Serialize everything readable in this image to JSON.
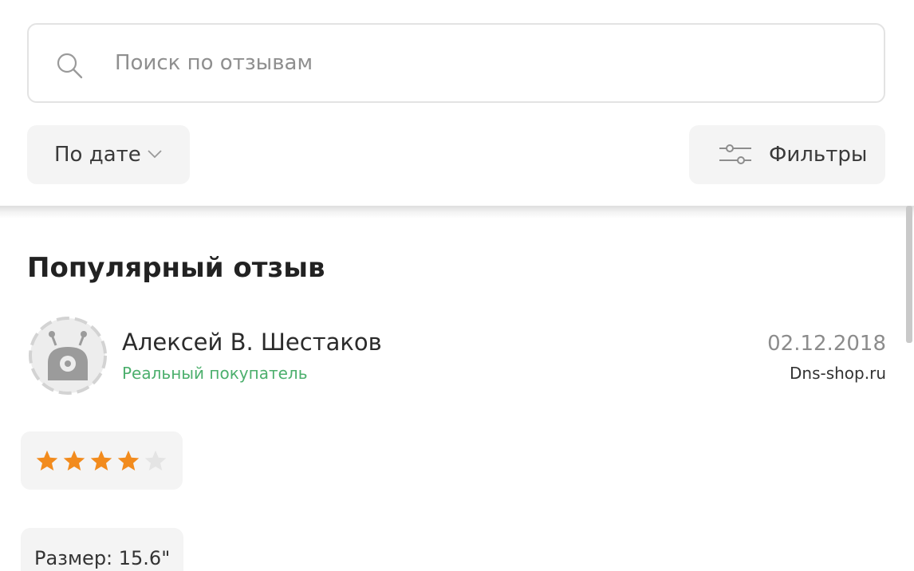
{
  "search": {
    "placeholder": "Поиск по отзывам",
    "value": ""
  },
  "sort": {
    "label": "По дате"
  },
  "filters": {
    "label": "Фильтры"
  },
  "popular_review": {
    "section_title": "Популярный отзыв",
    "author": "Алексей В. Шестаков",
    "badge": "Реальный покупатель",
    "date": "02.12.2018",
    "source": "Dns-shop.ru",
    "rating": 4,
    "rating_max": 5,
    "parameter": "Размер: 15.6\""
  },
  "colors": {
    "star_filled": "#f28b1d",
    "star_empty": "#e4e4e4",
    "badge_green": "#4caf6d"
  },
  "icons": {
    "search": "search-icon",
    "sort_chevron": "chevron-down-icon",
    "filters": "sliders-icon",
    "avatar": "robot-avatar-icon",
    "star": "star-icon"
  }
}
